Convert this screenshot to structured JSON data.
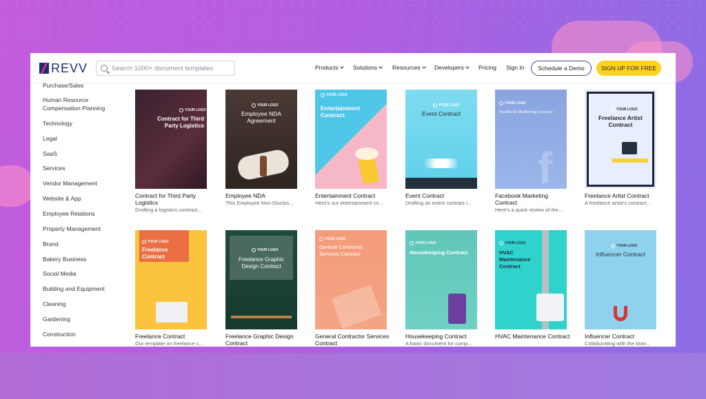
{
  "header": {
    "logo_text": "REVV",
    "search_placeholder": "Search 1000+ document templates",
    "nav": [
      {
        "label": "Products",
        "dropdown": true
      },
      {
        "label": "Solutions",
        "dropdown": true
      },
      {
        "label": "Resources",
        "dropdown": true
      },
      {
        "label": "Developers",
        "dropdown": true
      },
      {
        "label": "Pricing",
        "dropdown": false
      },
      {
        "label": "Sign In",
        "dropdown": false
      }
    ],
    "demo_button": "Schedule a Demo",
    "signup_button": "SIGN UP FOR FREE"
  },
  "sidebar": {
    "items": [
      "Purchase/Sales",
      "Human Resource",
      "Compensation Planning",
      "Technology",
      "Legal",
      "SaaS",
      "Services",
      "Vendor Management",
      "Website & App",
      "Employee Relations",
      "Property Management",
      "Brand",
      "Bakery Business",
      "Social Media",
      "Building and Equipment",
      "Cleaning",
      "Gardening",
      "Construction"
    ]
  },
  "colors": {
    "accent_yellow": "#ffd21f",
    "brand_navy": "#1f2a7a"
  },
  "templates": [
    {
      "thumb_title": "Contract for Third Party Logistics",
      "logo": "YOUR LOGO",
      "title": "Contract for Third Party Logistics",
      "desc": "Drafting a logistics contract..."
    },
    {
      "thumb_title": "Employee NDA Agreement",
      "logo": "YOUR LOGO",
      "title": "Employee NDA",
      "desc": "This Employee Non-Disclos..."
    },
    {
      "thumb_title": "Entertainment Contract",
      "logo": "YOUR LOGO",
      "title": "Entertainment Contract",
      "desc": "Here's our entertainment co..."
    },
    {
      "thumb_title": "Event Contract",
      "logo": "YOUR LOGO",
      "title": "Event Contract",
      "desc": "Drafting an event contract i..."
    },
    {
      "thumb_title": "Facebook Marketing Contract",
      "logo": "YOUR LOGO",
      "title": "Facebook Marketing Contract",
      "desc": "Here's a quick review of the..."
    },
    {
      "thumb_title": "Freelance Artist Contract",
      "logo": "YOUR LOGO",
      "title": "Freelance Artist Contract",
      "desc": "A freelance artist's contract..."
    },
    {
      "thumb_title": "Freelance Contract",
      "logo": "YOUR LOGO",
      "title": "Freelance Contract",
      "desc": "Our template on freelance c..."
    },
    {
      "thumb_title": "Freelance Graphic Design Contract",
      "logo": "YOUR LOGO",
      "title": "Freelance Graphic Design Contract",
      "desc": ""
    },
    {
      "thumb_title": "General Contractor Services Contract",
      "logo": "YOUR LOGO",
      "title": "General Contractor Services Contract",
      "desc": ""
    },
    {
      "thumb_title": "Housekeeping Contract",
      "logo": "YOUR LOGO",
      "title": "Housekeeping Contract",
      "desc": "A basic document for comp..."
    },
    {
      "thumb_title": "HVAC Maintenance Contract",
      "logo": "YOUR LOGO",
      "title": "HVAC Maintenance Contract",
      "desc": ""
    },
    {
      "thumb_title": "Influencer Contract",
      "logo": "YOUR LOGO",
      "title": "Influencer Contract",
      "desc": "Collaborating with the bran..."
    }
  ]
}
